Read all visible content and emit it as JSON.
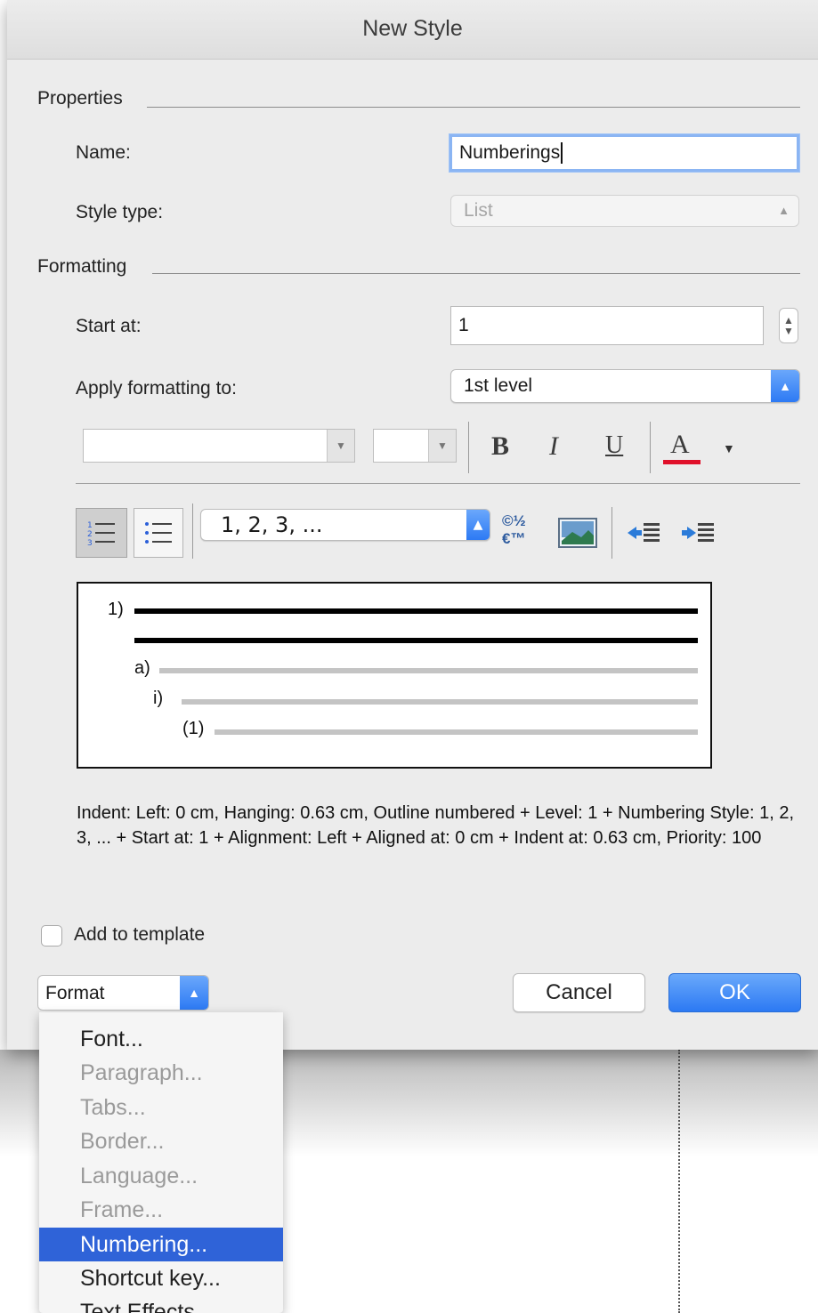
{
  "dialog": {
    "title": "New Style"
  },
  "properties": {
    "section_label": "Properties",
    "name_label": "Name:",
    "name_value": "Numberings",
    "style_type_label": "Style type:",
    "style_type_value": "List"
  },
  "formatting": {
    "section_label": "Formatting",
    "start_at_label": "Start at:",
    "start_at_value": "1",
    "apply_label": "Apply formatting to:",
    "apply_value": "1st level",
    "font_name": "",
    "font_size": "",
    "bold_label": "B",
    "italic_label": "I",
    "underline_label": "U",
    "font_color_label": "A",
    "font_color": "#e0102a",
    "number_style": "1, 2, 3, ...",
    "symbol_glyph": "©½€™"
  },
  "preview": {
    "labels": [
      "1)",
      "a)",
      "i)",
      "(1)"
    ],
    "primary_line_color": "#000000",
    "secondary_line_color": "#c4c4c4"
  },
  "description": "Indent: Left:  0 cm, Hanging:  0.63 cm, Outline numbered + Level: 1 + Numbering Style: 1, 2, 3, ... + Start at: 1 + Alignment: Left + Aligned at:  0 cm + Indent at:  0.63 cm, Priority: 100",
  "add_to_template_label": "Add to template",
  "format_button_label": "Format",
  "buttons": {
    "cancel": "Cancel",
    "ok": "OK"
  },
  "format_menu": {
    "items": [
      {
        "label": "Font...",
        "state": "enabled"
      },
      {
        "label": "Paragraph...",
        "state": "disabled"
      },
      {
        "label": "Tabs...",
        "state": "disabled"
      },
      {
        "label": "Border...",
        "state": "disabled"
      },
      {
        "label": "Language...",
        "state": "disabled"
      },
      {
        "label": "Frame...",
        "state": "disabled"
      },
      {
        "label": "Numbering...",
        "state": "selected"
      },
      {
        "label": "Shortcut key...",
        "state": "enabled"
      },
      {
        "label": "Text Effects...",
        "state": "enabled"
      }
    ]
  },
  "colors": {
    "accent": "#2f7af5",
    "menu_highlight": "#2f63d8"
  }
}
